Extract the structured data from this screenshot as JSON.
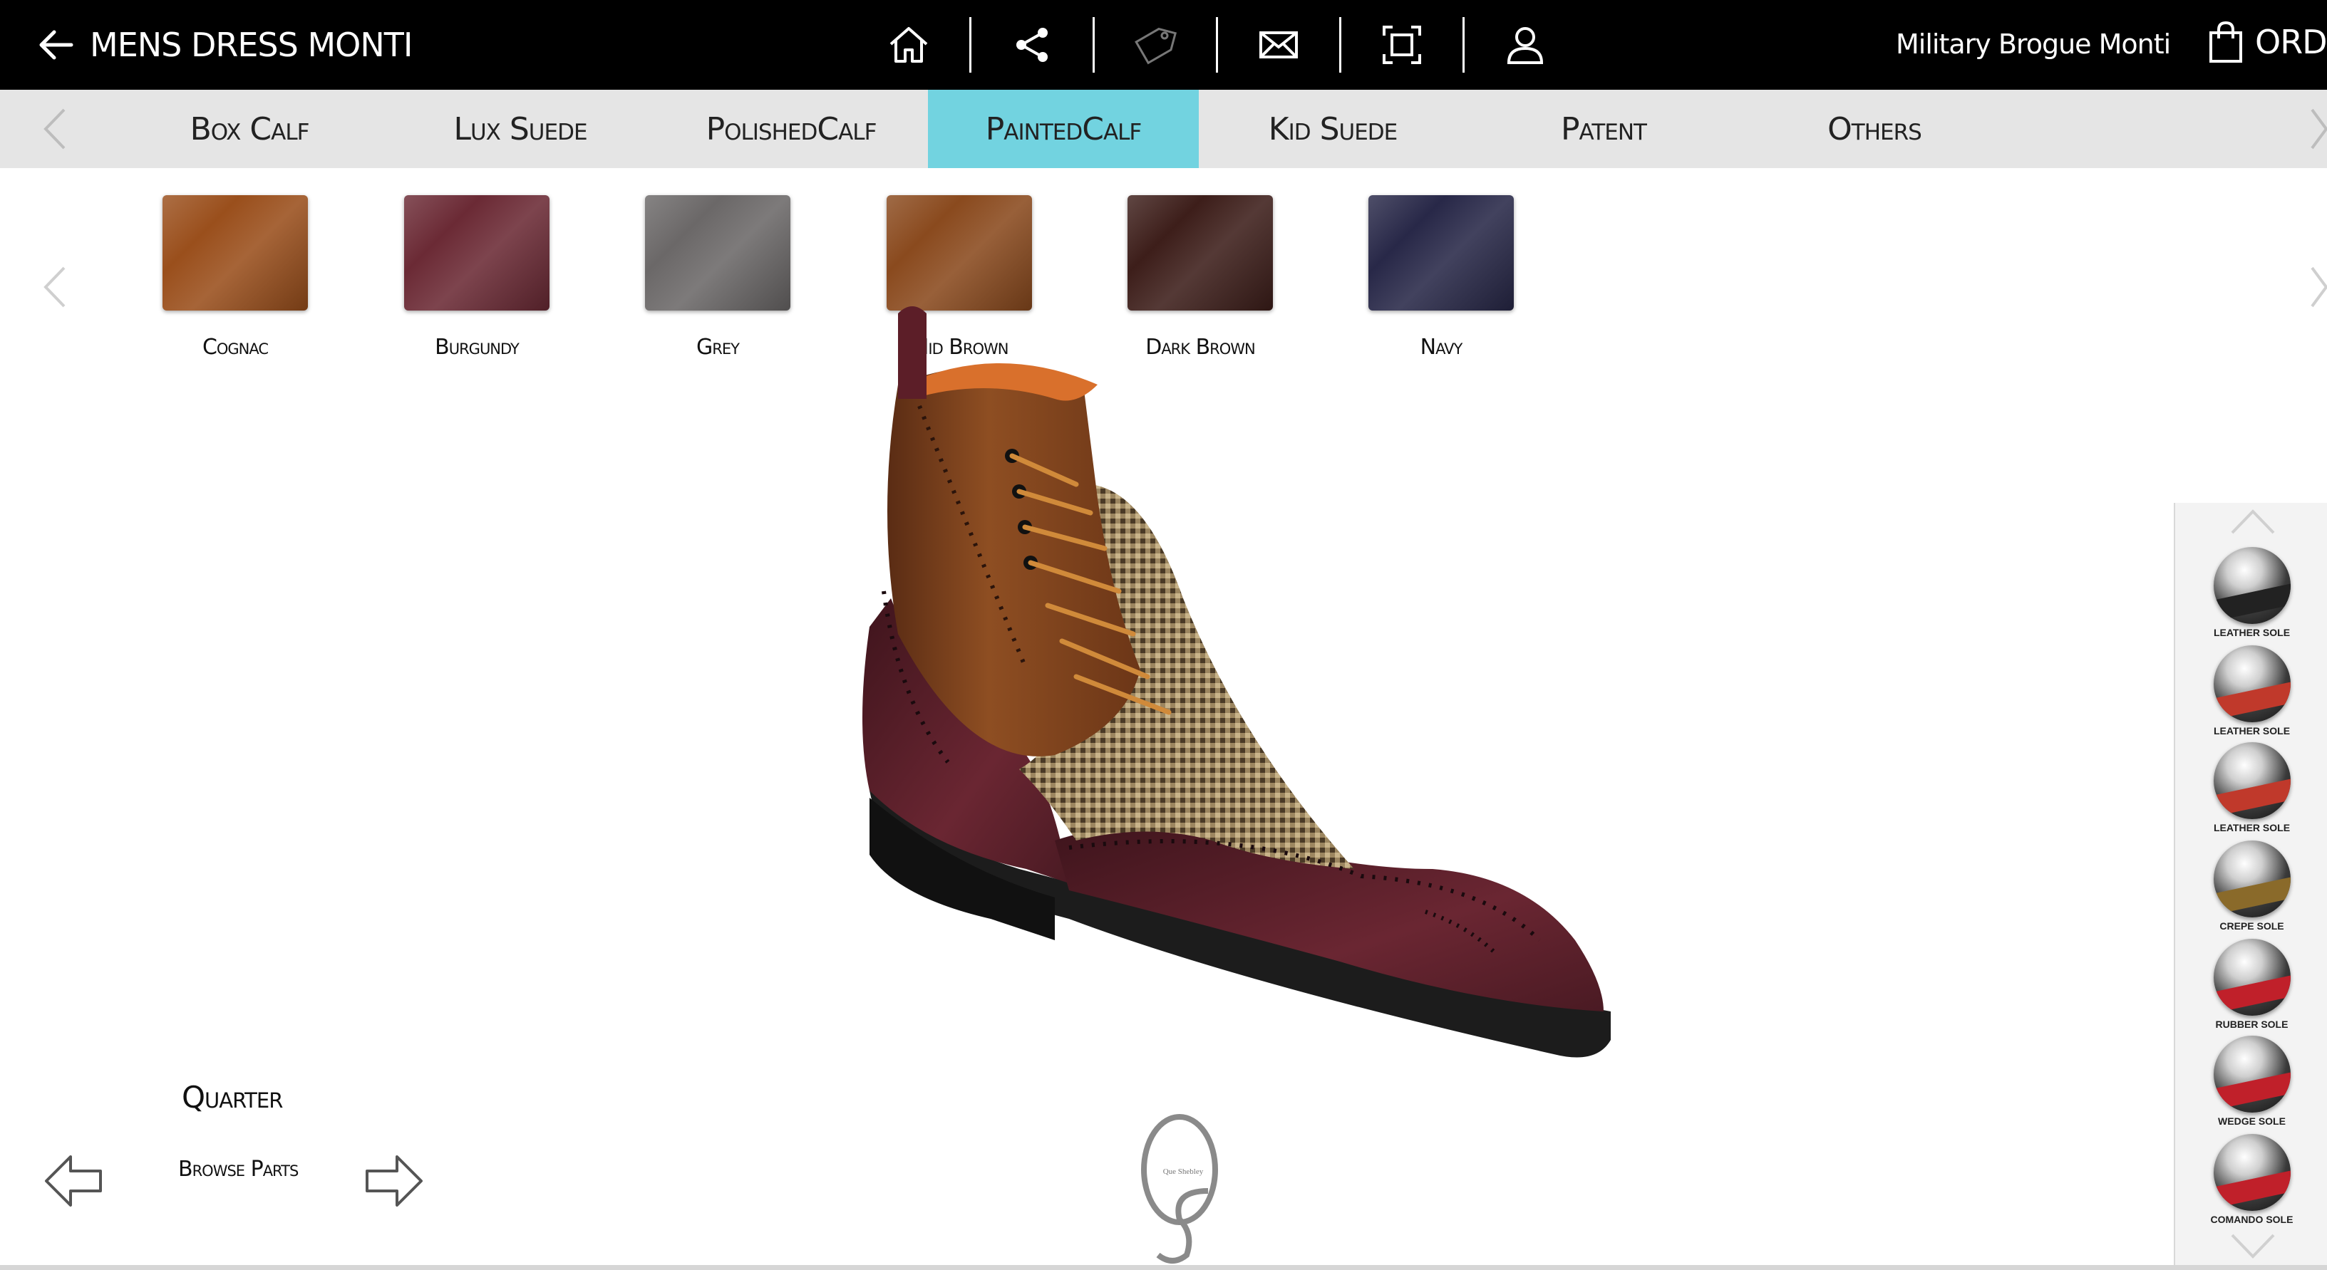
{
  "header": {
    "back_label": "MENS DRESS MONTI",
    "product_name": "Military Brogue Monti",
    "order_label": "ORDE",
    "tools": [
      "home-icon",
      "share-icon",
      "price-tag-icon",
      "mail-icon",
      "fullscreen-icon",
      "user-icon"
    ]
  },
  "material_tabs": [
    {
      "label": "Box Calf"
    },
    {
      "label": "Lux Suede"
    },
    {
      "label": "PolishedCalf"
    },
    {
      "label": "PaintedCalf",
      "active": true
    },
    {
      "label": "Kid Suede"
    },
    {
      "label": "Patent"
    },
    {
      "label": "Others"
    }
  ],
  "swatches": [
    {
      "label": "Cognac",
      "color": "#9a4f1c"
    },
    {
      "label": "Burgundy",
      "color": "#6b2a35"
    },
    {
      "label": "Grey",
      "color": "#6b6868"
    },
    {
      "label": "Mid Brown",
      "color": "#8a4a1e"
    },
    {
      "label": "Dark Brown",
      "color": "#3d1e1a"
    },
    {
      "label": "Navy",
      "color": "#282848"
    }
  ],
  "parts": {
    "current": "Quarter",
    "browse_label": "Browse Parts"
  },
  "logo_text": "Que Shebley",
  "soles": [
    {
      "label": "Leather Sole",
      "accent": "#222222"
    },
    {
      "label": "Leather Sole",
      "accent": "#c0392b"
    },
    {
      "label": "Leather Sole",
      "accent": "#c0392b"
    },
    {
      "label": "Crepe Sole",
      "accent": "#8a6a2a"
    },
    {
      "label": "Rubber Sole",
      "accent": "#c0202a"
    },
    {
      "label": "Wedge Sole",
      "accent": "#c0202a"
    },
    {
      "label": "Comando Sole",
      "accent": "#c0202a"
    }
  ]
}
